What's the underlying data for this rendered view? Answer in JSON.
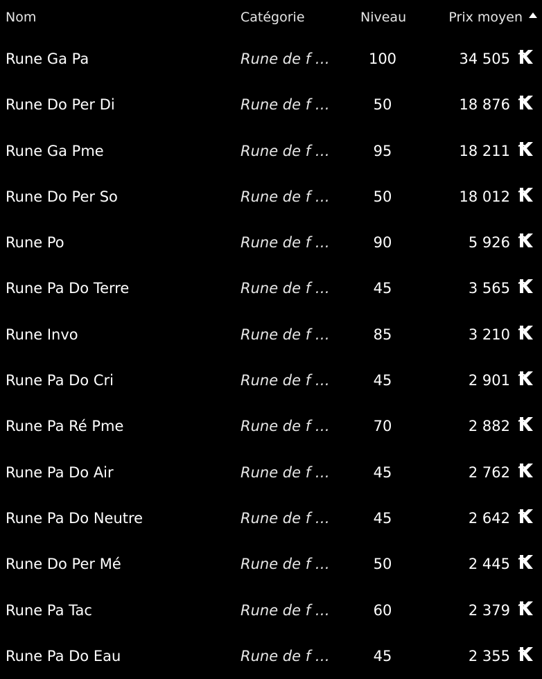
{
  "table": {
    "columns": {
      "name": "Nom",
      "category": "Catégorie",
      "level": "Niveau",
      "price": "Prix moyen"
    },
    "sort": {
      "column": "price",
      "direction": "descending",
      "icon": "sort-up-triangle"
    },
    "currency_icon": "kamas-icon",
    "rows": [
      {
        "name": "Rune Ga Pa",
        "category": "Rune de f …",
        "level": "100",
        "price": "34 505"
      },
      {
        "name": "Rune Do Per Di",
        "category": "Rune de f …",
        "level": "50",
        "price": "18 876"
      },
      {
        "name": "Rune Ga Pme",
        "category": "Rune de f …",
        "level": "95",
        "price": "18 211"
      },
      {
        "name": "Rune Do Per So",
        "category": "Rune de f …",
        "level": "50",
        "price": "18 012"
      },
      {
        "name": "Rune Po",
        "category": "Rune de f …",
        "level": "90",
        "price": "5 926"
      },
      {
        "name": "Rune Pa Do Terre",
        "category": "Rune de f …",
        "level": "45",
        "price": "3 565"
      },
      {
        "name": "Rune Invo",
        "category": "Rune de f …",
        "level": "85",
        "price": "3 210"
      },
      {
        "name": "Rune Pa Do Cri",
        "category": "Rune de f …",
        "level": "45",
        "price": "2 901"
      },
      {
        "name": "Rune Pa Ré Pme",
        "category": "Rune de f …",
        "level": "70",
        "price": "2 882"
      },
      {
        "name": "Rune Pa Do Air",
        "category": "Rune de f …",
        "level": "45",
        "price": "2 762"
      },
      {
        "name": "Rune Pa Do Neutre",
        "category": "Rune de f …",
        "level": "45",
        "price": "2 642"
      },
      {
        "name": "Rune Do Per Mé",
        "category": "Rune de f …",
        "level": "50",
        "price": "2 445"
      },
      {
        "name": "Rune Pa Tac",
        "category": "Rune de f …",
        "level": "60",
        "price": "2 379"
      },
      {
        "name": "Rune Pa Do Eau",
        "category": "Rune de f …",
        "level": "45",
        "price": "2 355"
      }
    ]
  }
}
